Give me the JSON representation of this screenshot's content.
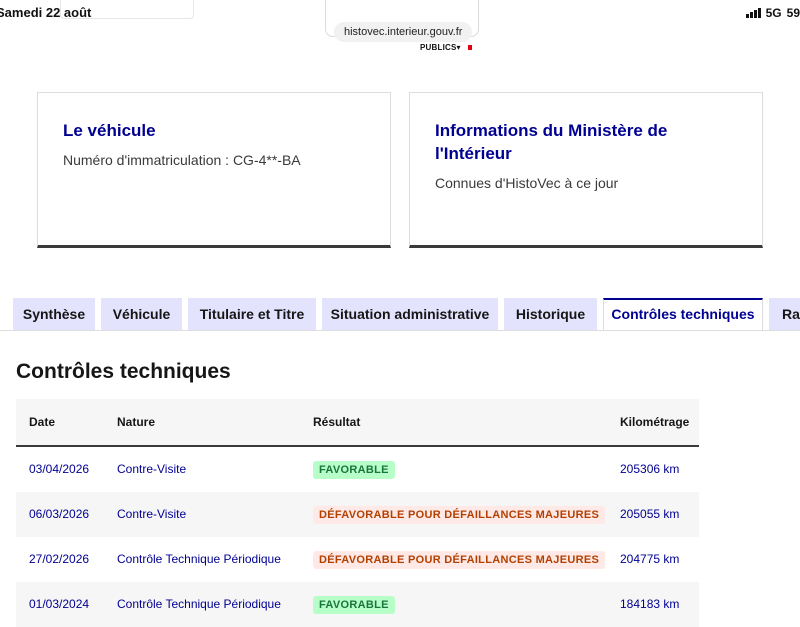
{
  "status_bar": {
    "time": "Samedi 22 août",
    "network": "5G",
    "battery": "59"
  },
  "browser": {
    "url": "histovec.interieur.gouv.fr"
  },
  "header": {
    "publics": "PUBLICS▾"
  },
  "cards": {
    "vehicle": {
      "title": "Le véhicule",
      "text": "Numéro d'immatriculation : CG-4**-BA"
    },
    "ministry": {
      "title_line1": "Informations du Ministère de",
      "title_line2": "l'Intérieur",
      "text": "Connues d'HistoVec à ce jour"
    }
  },
  "tabs": [
    {
      "label": "Synthèse",
      "active": false
    },
    {
      "label": "Véhicule",
      "active": false
    },
    {
      "label": "Titulaire et Titre",
      "active": false
    },
    {
      "label": "Situation administrative",
      "active": false
    },
    {
      "label": "Historique",
      "active": false
    },
    {
      "label": "Contrôles techniques",
      "active": true
    },
    {
      "label": "Rapport",
      "active": false
    }
  ],
  "panel": {
    "title": "Contrôles techniques",
    "table": {
      "headers": [
        "Date",
        "Nature",
        "Résultat",
        "Kilométrage"
      ],
      "rows": [
        {
          "date": "03/04/2026",
          "nature": "Contre-Visite",
          "result": "FAVORABLE",
          "km": "205306 km"
        },
        {
          "date": "06/03/2026",
          "nature": "Contre-Visite",
          "result": "DÉFAVORABLE POUR DÉFAILLANCES MAJEURES",
          "km": "205055 km"
        },
        {
          "date": "27/02/2026",
          "nature": "Contrôle Technique Périodique",
          "result": "DÉFAVORABLE POUR DÉFAILLANCES MAJEURES",
          "km": "204775 km"
        },
        {
          "date": "01/03/2024",
          "nature": "Contrôle Technique Périodique",
          "result": "FAVORABLE",
          "km": "184183 km"
        }
      ]
    }
  },
  "colors": {
    "primary": "#000091",
    "tab_bg": "#e3e3fd",
    "success_bg": "#b8fec9",
    "success_text": "#18753c",
    "error_bg": "#ffe9e6",
    "error_text": "#b34000"
  }
}
